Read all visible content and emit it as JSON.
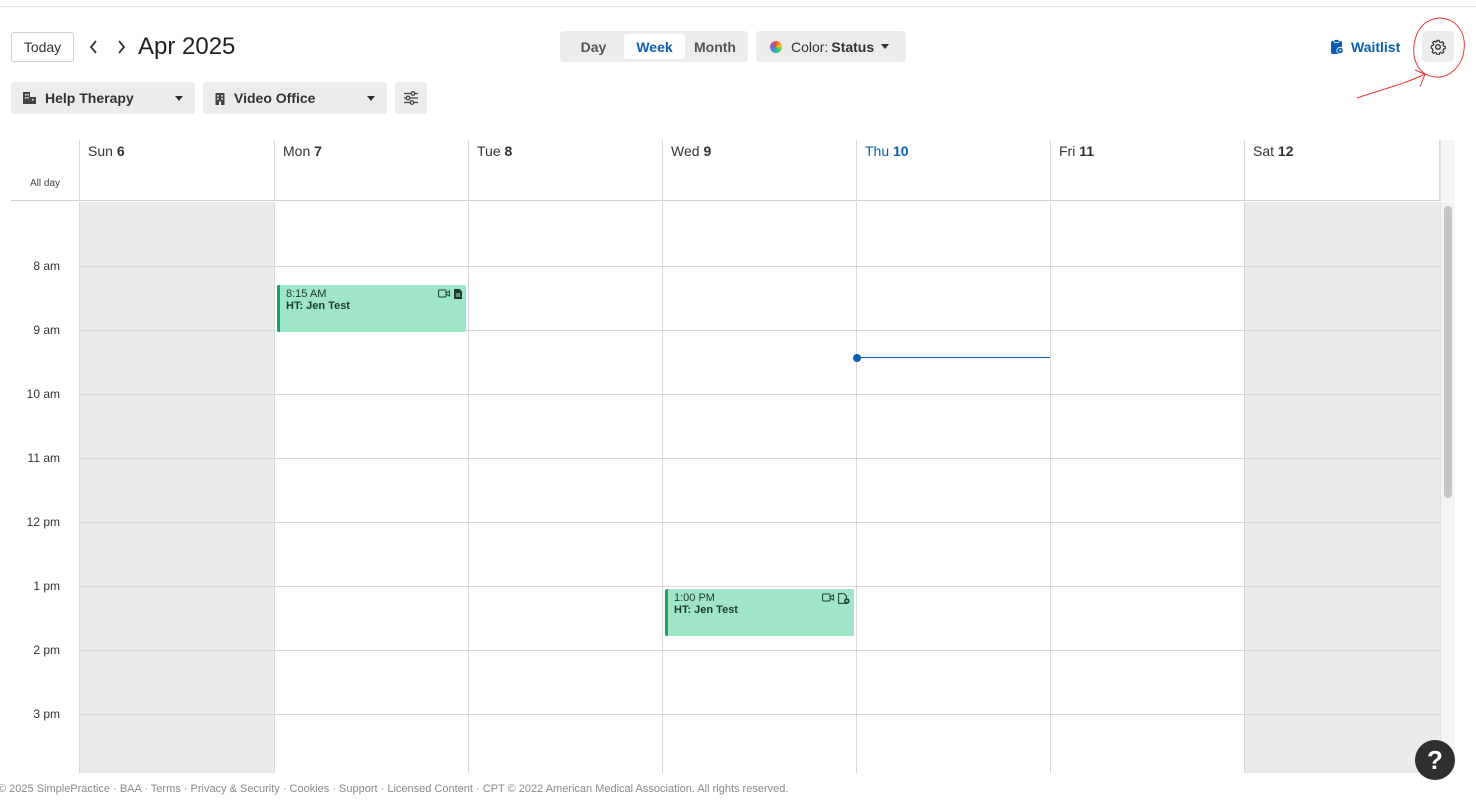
{
  "toolbar": {
    "today_label": "Today",
    "month_title": "Apr 2025",
    "views": {
      "day": "Day",
      "week": "Week",
      "month": "Month",
      "active": "Week"
    },
    "color": {
      "prefix": "Color:",
      "value": "Status"
    },
    "waitlist_label": "Waitlist",
    "practice_select": "Help Therapy",
    "office_select": "Video Office"
  },
  "calendar": {
    "days": [
      {
        "name": "Sun",
        "num": "6"
      },
      {
        "name": "Mon",
        "num": "7"
      },
      {
        "name": "Tue",
        "num": "8"
      },
      {
        "name": "Wed",
        "num": "9"
      },
      {
        "name": "Thu",
        "num": "10"
      },
      {
        "name": "Fri",
        "num": "11"
      },
      {
        "name": "Sat",
        "num": "12"
      }
    ],
    "today": "Thu 10",
    "all_day_label": "All day",
    "hours": [
      "8 am",
      "9 am",
      "10 am",
      "11 am",
      "12 pm",
      "1 pm",
      "2 pm",
      "3 pm"
    ],
    "events": [
      {
        "day": "Mon 7",
        "time": "8:15 AM",
        "title": "HT: Jen Test",
        "icons": [
          "video-icon",
          "note-icon"
        ]
      },
      {
        "day": "Wed 9",
        "time": "1:00 PM",
        "title": "HT: Jen Test",
        "icons": [
          "video-icon",
          "note-add-icon"
        ]
      }
    ]
  },
  "footer": {
    "text": "© 2025 SimplePractice · BAA · Terms · Privacy & Security · Cookies · Support · Licensed Content · CPT © 2022 American Medical Association. All rights reserved."
  },
  "help_label": "?",
  "colors": {
    "accent": "#0a5fb4",
    "event_bg": "#9fe6c8",
    "event_border": "#1aa06a",
    "weekend_bg": "#ebebeb",
    "annotation": "#e53935"
  }
}
